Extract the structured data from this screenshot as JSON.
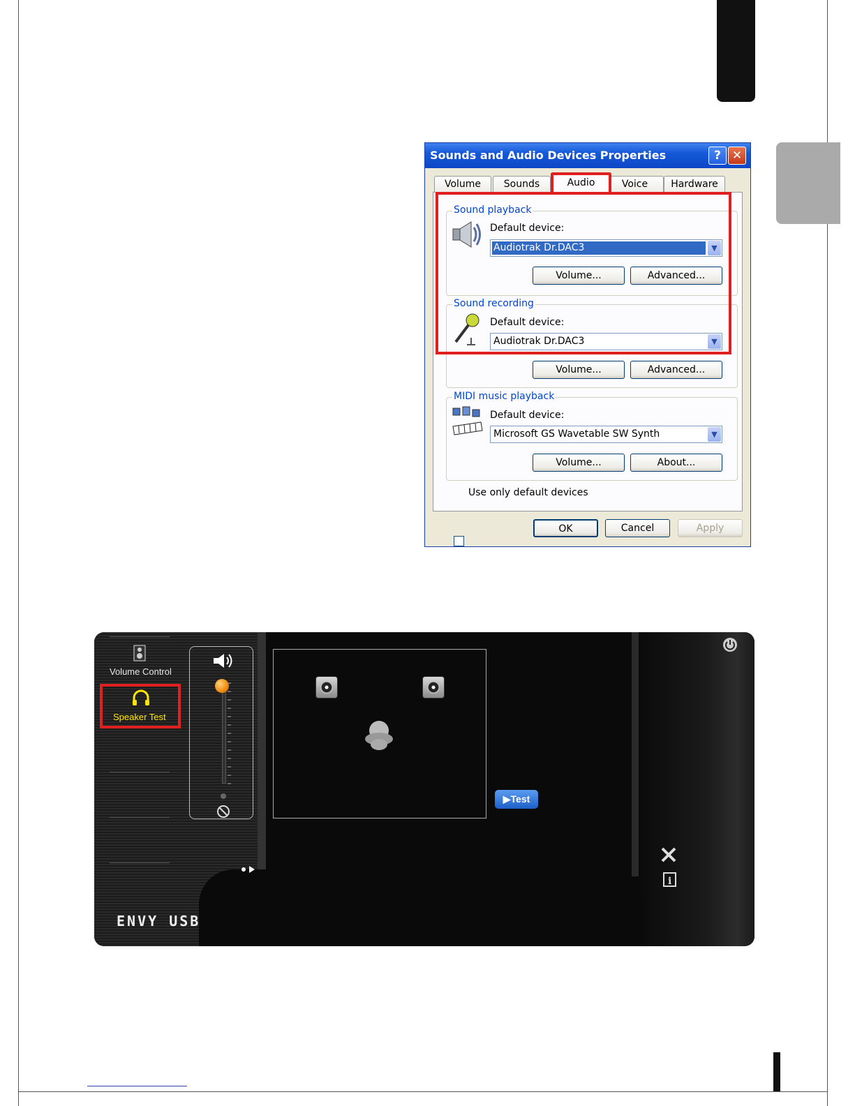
{
  "dialog": {
    "title": "Sounds and Audio Devices Properties",
    "help_glyph": "?",
    "close_glyph": "✕",
    "tabs": [
      {
        "label": "Volume"
      },
      {
        "label": "Sounds"
      },
      {
        "label": "Audio",
        "active": true
      },
      {
        "label": "Voice"
      },
      {
        "label": "Hardware"
      }
    ],
    "playback": {
      "title": "Sound playback",
      "device_label": "Default device:",
      "device_value": "Audiotrak Dr.DAC3",
      "volume_button": "Volume...",
      "advanced_button": "Advanced..."
    },
    "recording": {
      "title": "Sound recording",
      "device_label": "Default device:",
      "device_value": "Audiotrak Dr.DAC3",
      "volume_button": "Volume...",
      "advanced_button": "Advanced..."
    },
    "midi": {
      "title": "MIDI music playback",
      "device_label": "Default device:",
      "device_value": "Microsoft GS Wavetable SW Synth",
      "volume_button": "Volume...",
      "about_button": "About..."
    },
    "use_default_label": "Use only default devices",
    "ok_button": "OK",
    "cancel_button": "Cancel",
    "apply_button": "Apply",
    "highlight_color": "#e0201e"
  },
  "envy": {
    "nav": [
      {
        "label": "Volume Control",
        "icon": "speaker-icon"
      },
      {
        "label": "Speaker Test",
        "icon": "headphones-icon",
        "selected": true
      }
    ],
    "test_button": "Test",
    "logo_text": "ENVY USB",
    "volume_level": 1.0,
    "accent_color": "#ffe600"
  }
}
